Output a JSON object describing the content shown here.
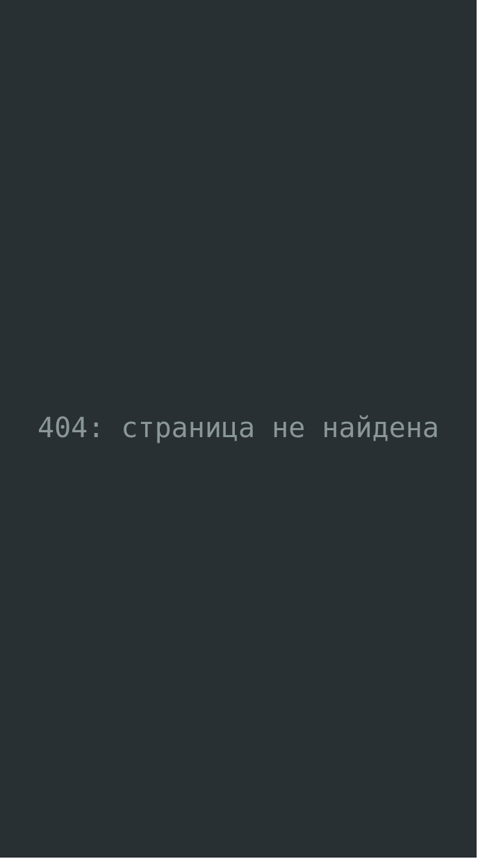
{
  "error": {
    "message": "404: страница не найдена"
  },
  "colors": {
    "background": "#293033",
    "text": "#8a9799"
  }
}
